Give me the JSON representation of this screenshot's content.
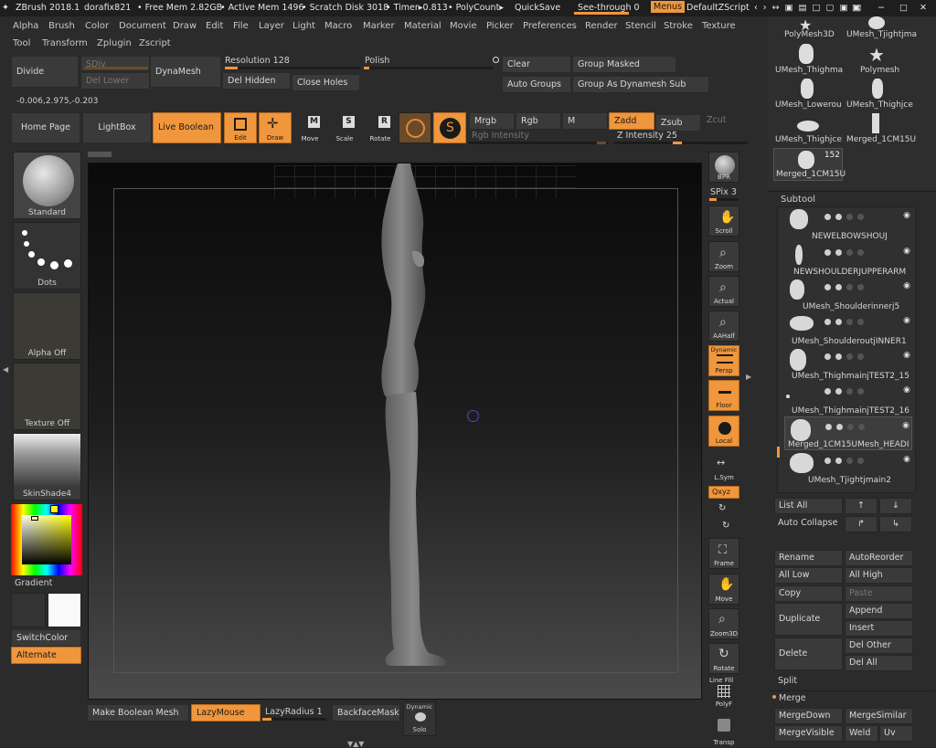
{
  "titlebar": {
    "app": "ZBrush 2018.1",
    "user": "dorafix821",
    "free_mem": "• Free Mem 2.82GB",
    "active_mem": "• Active Mem 1496",
    "scratch": "• Scratch Disk 3018",
    "timer": "• Timer▸0.813",
    "polycount": "• PolyCount▸",
    "quicksave": "QuickSave",
    "see_through": "See-through  0",
    "menus": "Menus",
    "zscript": "DefaultZScript"
  },
  "menus_row1": [
    "Alpha",
    "Brush",
    "Color",
    "Document",
    "Draw",
    "Edit",
    "File",
    "Layer",
    "Light",
    "Macro",
    "Marker",
    "Material",
    "Movie",
    "Picker",
    "Preferences",
    "Render",
    "Stencil",
    "Stroke",
    "Texture"
  ],
  "menus_row2": [
    "Tool",
    "Transform",
    "Zplugin",
    "Zscript"
  ],
  "geometry": {
    "divide": "Divide",
    "sdiv": "SDiv",
    "del_lower": "Del Lower",
    "dynamesh": "DynaMesh",
    "resolution": "Resolution 128",
    "resolution_value": 128,
    "del_hidden": "Del Hidden",
    "close_holes": "Close Holes",
    "polish": "Polish",
    "clear": "Clear",
    "group_masked": "Group Masked",
    "auto_groups": "Auto Groups",
    "group_as_dynamesh": "Group As Dynamesh Sub"
  },
  "coords": "-0.006,2.975,-0.203",
  "toolbar": {
    "home_page": "Home Page",
    "lightbox": "LightBox",
    "live_boolean": "Live Boolean",
    "edit": "Edit",
    "draw": "Draw",
    "move": "Move",
    "scale": "Scale",
    "rotate": "Rotate",
    "mrgb": "Mrgb",
    "rgb": "Rgb",
    "m": "M",
    "zadd": "Zadd",
    "zsub": "Zsub",
    "zcut": "Zcut",
    "rgb_intensity": "Rgb Intensity",
    "z_intensity": "Z Intensity 25",
    "z_intensity_value": 25
  },
  "left_shelf": {
    "brush": "Standard",
    "stroke": "Dots",
    "alpha": "Alpha Off",
    "texture": "Texture Off",
    "material": "SkinShade4",
    "gradient": "Gradient",
    "switchcolor": "SwitchColor",
    "alternate": "Alternate"
  },
  "right_shelf": {
    "bpr": "BPR",
    "spix": "SPix 3",
    "scroll": "Scroll",
    "zoom": "Zoom",
    "actual": "Actual",
    "aahalf": "AAHalf",
    "dynamic": "Dynamic",
    "persp": "Persp",
    "floor": "Floor",
    "local": "Local",
    "lsym": "L.Sym",
    "xyz": "Qxyz",
    "frame": "Frame",
    "move": "Move",
    "zoom3d": "Zoom3D",
    "rotate": "Rotate",
    "line_fill": "Line Fill",
    "polyf": "PolyF",
    "transp": "Transp"
  },
  "bottom_bar": {
    "make_boolean": "Make Boolean Mesh",
    "lazymouse": "LazyMouse",
    "lazyradius": "LazyRadius 1",
    "backfacemask": "BackfaceMask",
    "dynamic": "Dynamic",
    "solo": "Solo"
  },
  "tool_thumbs": [
    {
      "label": "PolyMesh3D"
    },
    {
      "label": "UMesh_Tjightjma"
    },
    {
      "label": "UMesh_Thighma"
    },
    {
      "label": "Polymesh"
    },
    {
      "label": "UMesh_Lowerou"
    },
    {
      "label": "UMesh_Thighjce"
    },
    {
      "label": "UMesh_Thighjce"
    },
    {
      "label": "Merged_1CM15U"
    },
    {
      "label": "Merged_1CM15U"
    }
  ],
  "tool_count": "152",
  "subtool": {
    "header": "Subtool",
    "items": [
      {
        "name": "NEWELBOWSHOUJ"
      },
      {
        "name": "NEWSHOULDERJUPPERARM"
      },
      {
        "name": "UMesh_Shoulderinnerj5"
      },
      {
        "name": "UMesh_ShoulderoutjINNER1"
      },
      {
        "name": "UMesh_ThighmainjTEST2_15"
      },
      {
        "name": "UMesh_ThighmainjTEST2_16"
      },
      {
        "name": "Merged_1CM15UMesh_HEADI"
      },
      {
        "name": "UMesh_Tjightjmain2"
      }
    ],
    "list_all": "List All",
    "auto_collapse": "Auto Collapse",
    "rename": "Rename",
    "autoreorder": "AutoReorder",
    "all_low": "All Low",
    "all_high": "All High",
    "copy": "Copy",
    "paste": "Paste",
    "duplicate": "Duplicate",
    "append": "Append",
    "insert": "Insert",
    "delete": "Delete",
    "del_other": "Del Other",
    "del_all": "Del All",
    "split": "Split",
    "merge": "Merge",
    "merge_down": "MergeDown",
    "merge_similar": "MergeSimilar",
    "merge_visible": "MergeVisible",
    "weld": "Weld",
    "uv": "Uv"
  },
  "colors": {
    "accent": "#f0963c",
    "panel": "#2b2b2b",
    "button": "#3a3a3a"
  }
}
